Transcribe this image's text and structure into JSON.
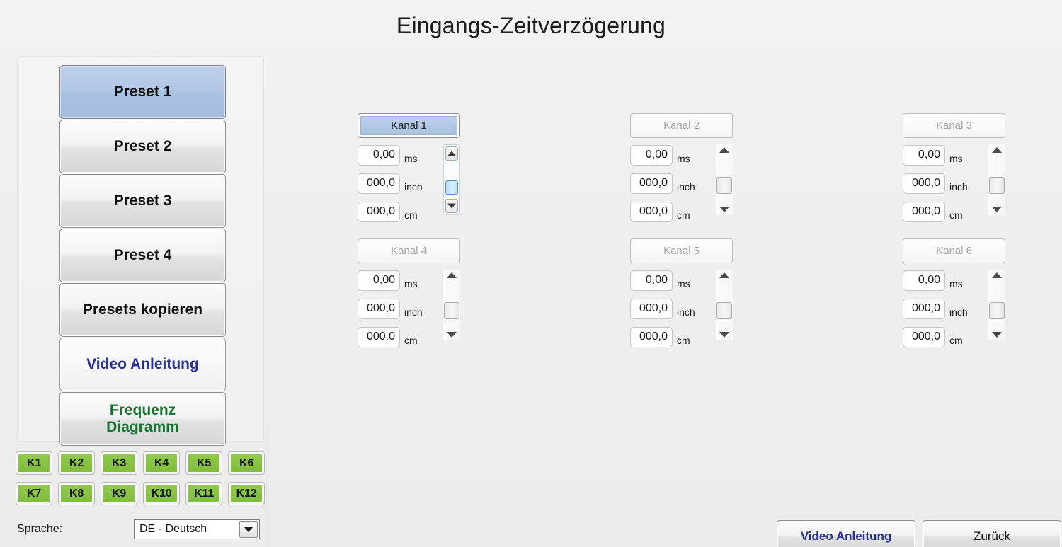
{
  "header": {
    "title": "Eingangs-Zeitverzögerung"
  },
  "sidebar": {
    "presets": [
      {
        "label": "Preset 1",
        "selected": true
      },
      {
        "label": "Preset 2",
        "selected": false
      },
      {
        "label": "Preset 3",
        "selected": false
      },
      {
        "label": "Preset 4",
        "selected": false
      }
    ],
    "copy_presets_label": "Presets kopieren",
    "video_guide_label": "Video Anleitung",
    "frequency_diagram_line1": "Frequenz",
    "frequency_diagram_line2": "Diagramm",
    "k_buttons": [
      "K1",
      "K2",
      "K3",
      "K4",
      "K5",
      "K6",
      "K7",
      "K8",
      "K9",
      "K10",
      "K11",
      "K12"
    ]
  },
  "channels": [
    {
      "name": "Kanal 1",
      "active": true,
      "ms": "0,00",
      "inch": "000,0",
      "cm": "000,0",
      "unit_ms": "ms",
      "unit_inch": "inch",
      "unit_cm": "cm"
    },
    {
      "name": "Kanal 2",
      "active": false,
      "ms": "0,00",
      "inch": "000,0",
      "cm": "000,0",
      "unit_ms": "ms",
      "unit_inch": "inch",
      "unit_cm": "cm"
    },
    {
      "name": "Kanal 3",
      "active": false,
      "ms": "0,00",
      "inch": "000,0",
      "cm": "000,0",
      "unit_ms": "ms",
      "unit_inch": "inch",
      "unit_cm": "cm"
    },
    {
      "name": "Kanal 4",
      "active": false,
      "ms": "0,00",
      "inch": "000,0",
      "cm": "000,0",
      "unit_ms": "ms",
      "unit_inch": "inch",
      "unit_cm": "cm"
    },
    {
      "name": "Kanal 5",
      "active": false,
      "ms": "0,00",
      "inch": "000,0",
      "cm": "000,0",
      "unit_ms": "ms",
      "unit_inch": "inch",
      "unit_cm": "cm"
    },
    {
      "name": "Kanal 6",
      "active": false,
      "ms": "0,00",
      "inch": "000,0",
      "cm": "000,0",
      "unit_ms": "ms",
      "unit_inch": "inch",
      "unit_cm": "cm"
    }
  ],
  "footer": {
    "language_label": "Sprache:",
    "language_value": "DE - Deutsch",
    "video_guide_label": "Video Anleitung",
    "back_label": "Zurück"
  },
  "colors": {
    "selected_blue": "#a9c1e1",
    "k_button_green": "#80bd3c",
    "video_link_blue": "#24309c",
    "frequency_green": "#11742f",
    "background": "#efefef"
  }
}
